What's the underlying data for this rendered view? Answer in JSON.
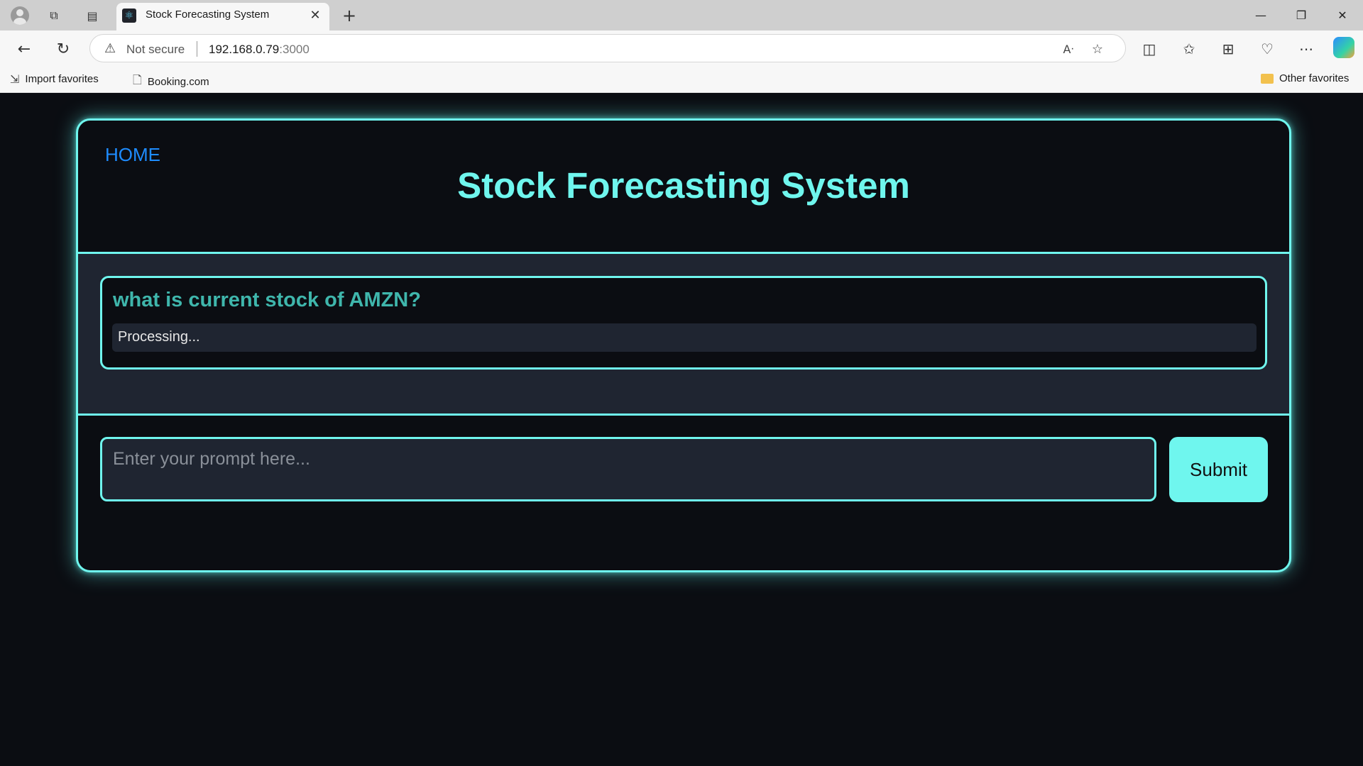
{
  "browser": {
    "tab_title": "Stock Forecasting System",
    "address": {
      "security_label": "Not secure",
      "host": "192.168.0.79",
      "port": ":3000"
    },
    "favorites": {
      "import_label": "Import favorites",
      "booking_label": "Booking.com",
      "other_label": "Other favorites"
    }
  },
  "page": {
    "home_link": "HOME",
    "title": "Stock Forecasting System",
    "messages": [
      {
        "question": "what is current stock of AMZN?",
        "response": "Processing..."
      }
    ],
    "prompt": {
      "placeholder": "Enter your prompt here...",
      "value": ""
    },
    "submit_label": "Submit"
  },
  "colors": {
    "accent": "#6ff6ee",
    "question_text": "#3fb6ac",
    "link": "#1e8cff",
    "background": "#0b0d12",
    "panel": "#1f2531"
  }
}
